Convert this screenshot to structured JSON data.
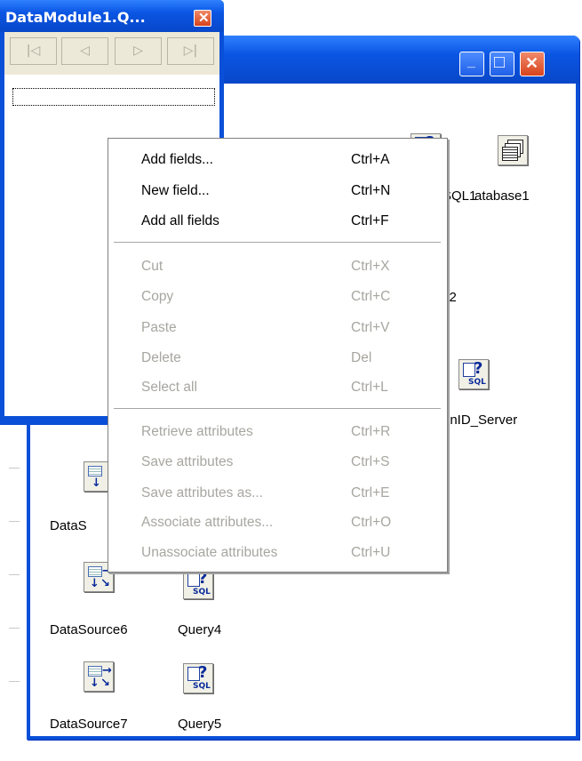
{
  "navigator": {
    "title": "DataModule1.Q...",
    "close_glyph": "✕",
    "buttons": [
      {
        "name": "first-record-button",
        "glyph": "|◁"
      },
      {
        "name": "prior-record-button",
        "glyph": "◁"
      },
      {
        "name": "next-record-button",
        "glyph": "▷"
      },
      {
        "name": "last-record-button",
        "glyph": "▷|"
      }
    ]
  },
  "main_window": {
    "minimize_glyph": "_",
    "maximize_glyph": "□",
    "close_glyph": "✕"
  },
  "components": {
    "sql1_label": "SQL1",
    "database1_label": "atabase1",
    "query2_label": "y2",
    "openid_label": "enID_Server",
    "ds_partial_label": "DataS",
    "ds6_label": "DataSource6",
    "q4_label": "Query4",
    "ds7_label": "DataSource7",
    "q5_label": "Query5",
    "sql_tag": "SQL"
  },
  "menu": {
    "group1": [
      {
        "label": "Add fields...",
        "shortcut": "Ctrl+A",
        "disabled": false
      },
      {
        "label": "New field...",
        "shortcut": "Ctrl+N",
        "disabled": false
      },
      {
        "label": "Add all fields",
        "shortcut": "Ctrl+F",
        "disabled": false
      }
    ],
    "group2": [
      {
        "label": "Cut",
        "shortcut": "Ctrl+X",
        "disabled": true
      },
      {
        "label": "Copy",
        "shortcut": "Ctrl+C",
        "disabled": true
      },
      {
        "label": "Paste",
        "shortcut": "Ctrl+V",
        "disabled": true
      },
      {
        "label": "Delete",
        "shortcut": "Del",
        "disabled": true
      },
      {
        "label": "Select all",
        "shortcut": "Ctrl+L",
        "disabled": true
      }
    ],
    "group3": [
      {
        "label": "Retrieve attributes",
        "shortcut": "Ctrl+R",
        "disabled": true
      },
      {
        "label": "Save attributes",
        "shortcut": "Ctrl+S",
        "disabled": true
      },
      {
        "label": "Save attributes as...",
        "shortcut": "Ctrl+E",
        "disabled": true
      },
      {
        "label": "Associate attributes...",
        "shortcut": "Ctrl+O",
        "disabled": true
      },
      {
        "label": "Unassociate attributes",
        "shortcut": "Ctrl+U",
        "disabled": true
      }
    ]
  },
  "colors": {
    "titlebar": "#0a55e3",
    "disabled_text": "#a7a6a0",
    "menu_bg": "#ffffff"
  }
}
